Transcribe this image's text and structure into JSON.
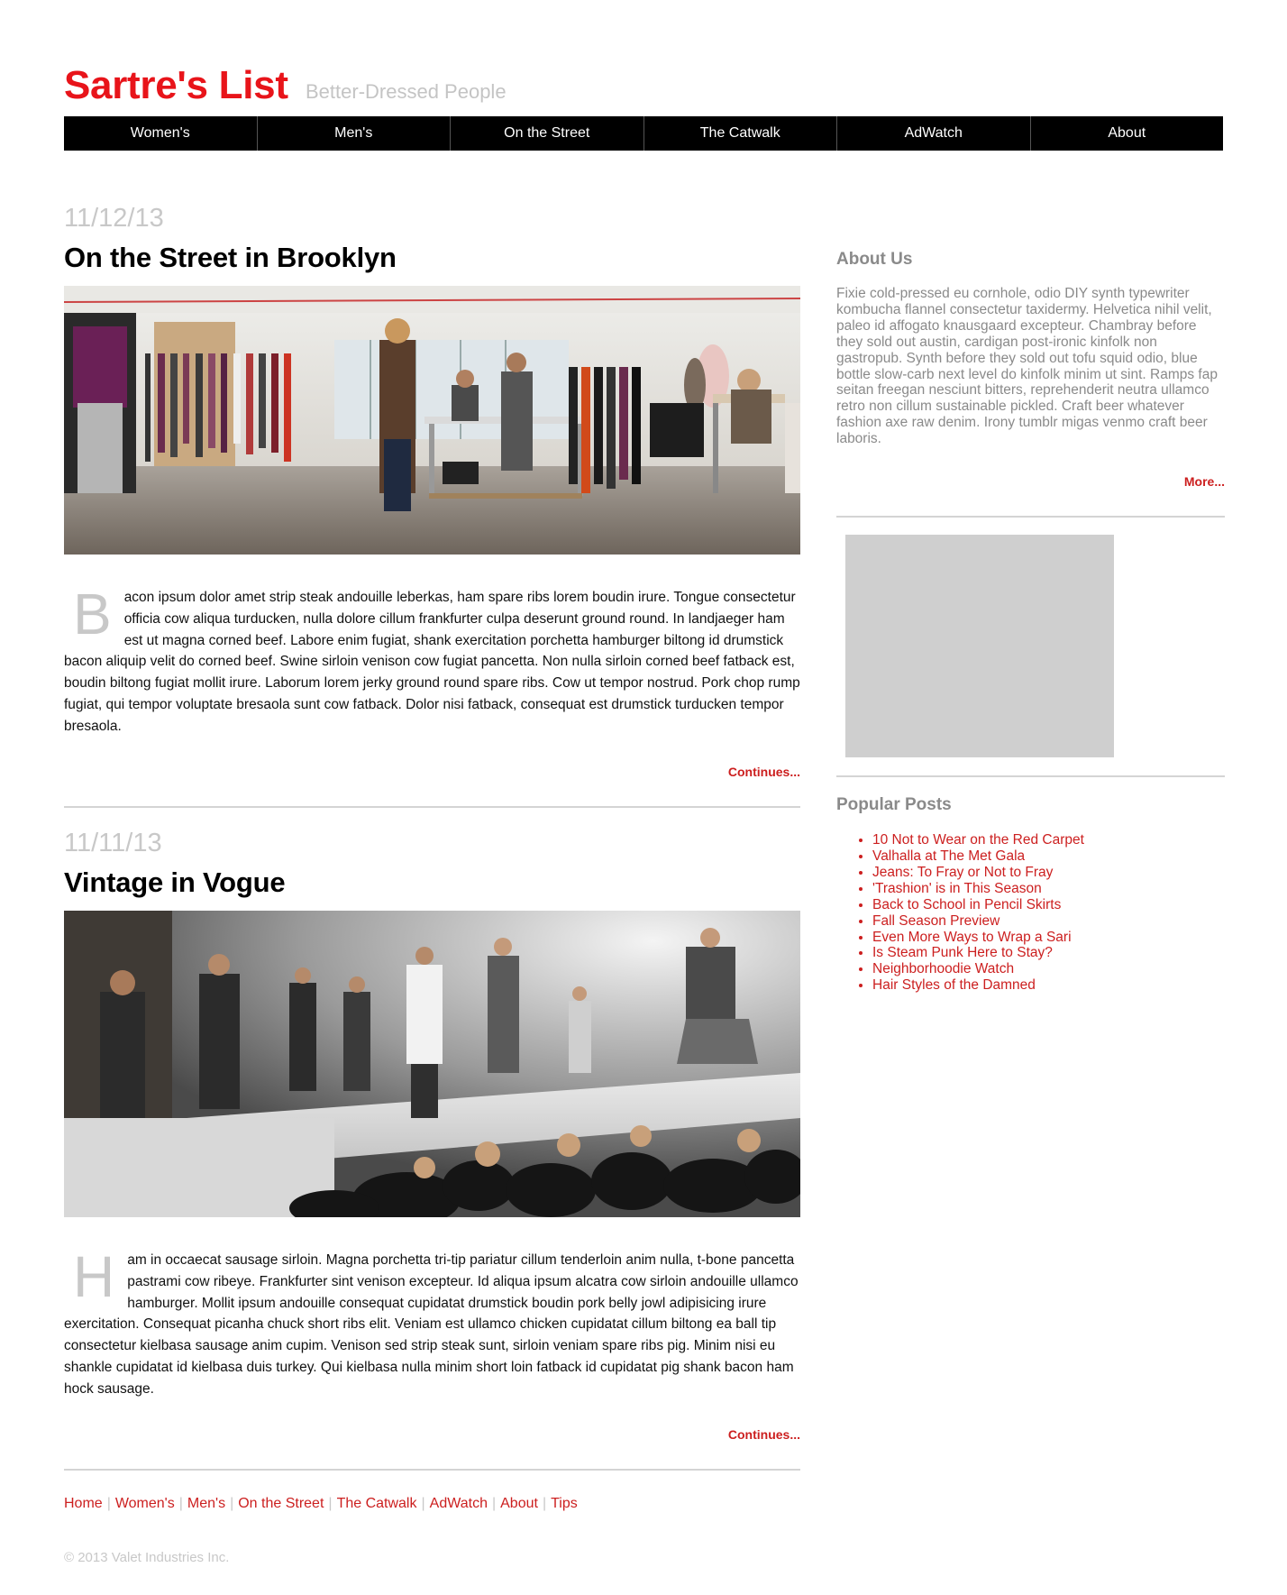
{
  "header": {
    "title": "Sartre's List",
    "tagline": "Better-Dressed People"
  },
  "nav": {
    "items": [
      "Women's",
      "Men's",
      "On the Street",
      "The Catwalk",
      "AdWatch",
      "About"
    ]
  },
  "posts": [
    {
      "date": "11/12/13",
      "title": "On the Street in Brooklyn",
      "image_desc": "studio-workshop-photo",
      "dropcap": "B",
      "body": "acon ipsum dolor amet strip steak andouille leberkas, ham spare ribs lorem boudin irure. Tongue consectetur officia cow aliqua turducken, nulla dolore cillum frankfurter culpa deserunt ground round. In landjaeger ham est ut magna corned beef. Labore enim fugiat, shank exercitation porchetta hamburger biltong id drumstick bacon aliquip velit do corned beef. Swine sirloin venison cow fugiat pancetta. Non nulla sirloin corned beef fatback est, boudin biltong fugiat mollit irure. Laborum lorem jerky ground round spare ribs. Cow ut tempor nostrud. Pork chop rump fugiat, qui tempor voluptate bresaola sunt cow fatback. Dolor nisi fatback, consequat est drumstick turducken tempor bresaola.",
      "continue_label": "Continues..."
    },
    {
      "date": "11/11/13",
      "title": "Vintage in Vogue",
      "image_desc": "runway-show-photo",
      "dropcap": "H",
      "body": "am in occaecat sausage sirloin. Magna porchetta tri-tip pariatur cillum tenderloin anim nulla, t-bone pancetta pastrami cow ribeye. Frankfurter sint venison excepteur. Id aliqua ipsum alcatra cow sirloin andouille ullamco hamburger. Mollit ipsum andouille consequat cupidatat drumstick boudin pork belly jowl adipisicing irure exercitation. Consequat picanha chuck short ribs elit. Veniam est ullamco chicken cupidatat cillum biltong ea ball tip consectetur kielbasa sausage anim cupim. Venison sed strip steak sunt, sirloin veniam spare ribs pig. Minim nisi eu shankle cupidatat id kielbasa duis turkey. Qui kielbasa nulla minim short loin fatback id cupidatat pig shank bacon ham hock sausage.",
      "continue_label": "Continues..."
    }
  ],
  "sidebar": {
    "about_heading": "About Us",
    "about_text": "Fixie cold-pressed eu cornhole, odio DIY synth typewriter kombucha flannel consectetur taxidermy. Helvetica nihil velit, paleo id affogato knausgaard excepteur. Chambray before they sold out austin, cardigan post-ironic kinfolk non gastropub. Synth before they sold out tofu squid odio, blue bottle slow-carb next level do kinfolk minim ut sint. Ramps fap seitan freegan nesciunt bitters, reprehenderit neutra ullamco retro non cillum sustainable pickled. Craft beer whatever fashion axe raw denim. Irony tumblr migas venmo craft beer laboris.",
    "more_label": "More...",
    "popular_heading": "Popular Posts",
    "popular": [
      "10 Not to Wear on the Red Carpet",
      "Valhalla at The Met Gala",
      "Jeans: To Fray or Not to Fray",
      "'Trashion' is in This Season",
      "Back to School in Pencil Skirts",
      "Fall Season Preview",
      "Even More Ways to Wrap a Sari",
      "Is Steam Punk Here to Stay?",
      "Neighborhoodie Watch",
      "Hair Styles of the Damned"
    ]
  },
  "footer": {
    "links": [
      "Home",
      "Women's",
      "Men's",
      "On the Street",
      "The Catwalk",
      "AdWatch",
      "About",
      "Tips"
    ],
    "copyright": "© 2013 Valet Industries Inc."
  },
  "colors": {
    "brand_red": "#e8141a",
    "link_red": "#cc1f1f",
    "muted_gray": "#8a8a8a",
    "light_gray": "#c8c8c8",
    "nav_bg": "#000000"
  }
}
